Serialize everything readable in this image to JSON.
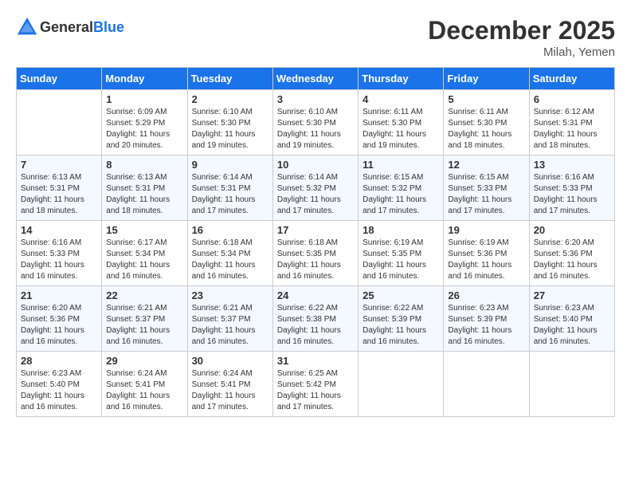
{
  "header": {
    "logo_general": "General",
    "logo_blue": "Blue",
    "month_title": "December 2025",
    "location": "Milah, Yemen"
  },
  "weekdays": [
    "Sunday",
    "Monday",
    "Tuesday",
    "Wednesday",
    "Thursday",
    "Friday",
    "Saturday"
  ],
  "weeks": [
    [
      {
        "day": "",
        "sunrise": "",
        "sunset": "",
        "daylight": ""
      },
      {
        "day": "1",
        "sunrise": "Sunrise: 6:09 AM",
        "sunset": "Sunset: 5:29 PM",
        "daylight": "Daylight: 11 hours and 20 minutes."
      },
      {
        "day": "2",
        "sunrise": "Sunrise: 6:10 AM",
        "sunset": "Sunset: 5:30 PM",
        "daylight": "Daylight: 11 hours and 19 minutes."
      },
      {
        "day": "3",
        "sunrise": "Sunrise: 6:10 AM",
        "sunset": "Sunset: 5:30 PM",
        "daylight": "Daylight: 11 hours and 19 minutes."
      },
      {
        "day": "4",
        "sunrise": "Sunrise: 6:11 AM",
        "sunset": "Sunset: 5:30 PM",
        "daylight": "Daylight: 11 hours and 19 minutes."
      },
      {
        "day": "5",
        "sunrise": "Sunrise: 6:11 AM",
        "sunset": "Sunset: 5:30 PM",
        "daylight": "Daylight: 11 hours and 18 minutes."
      },
      {
        "day": "6",
        "sunrise": "Sunrise: 6:12 AM",
        "sunset": "Sunset: 5:31 PM",
        "daylight": "Daylight: 11 hours and 18 minutes."
      }
    ],
    [
      {
        "day": "7",
        "sunrise": "Sunrise: 6:13 AM",
        "sunset": "Sunset: 5:31 PM",
        "daylight": "Daylight: 11 hours and 18 minutes."
      },
      {
        "day": "8",
        "sunrise": "Sunrise: 6:13 AM",
        "sunset": "Sunset: 5:31 PM",
        "daylight": "Daylight: 11 hours and 18 minutes."
      },
      {
        "day": "9",
        "sunrise": "Sunrise: 6:14 AM",
        "sunset": "Sunset: 5:31 PM",
        "daylight": "Daylight: 11 hours and 17 minutes."
      },
      {
        "day": "10",
        "sunrise": "Sunrise: 6:14 AM",
        "sunset": "Sunset: 5:32 PM",
        "daylight": "Daylight: 11 hours and 17 minutes."
      },
      {
        "day": "11",
        "sunrise": "Sunrise: 6:15 AM",
        "sunset": "Sunset: 5:32 PM",
        "daylight": "Daylight: 11 hours and 17 minutes."
      },
      {
        "day": "12",
        "sunrise": "Sunrise: 6:15 AM",
        "sunset": "Sunset: 5:33 PM",
        "daylight": "Daylight: 11 hours and 17 minutes."
      },
      {
        "day": "13",
        "sunrise": "Sunrise: 6:16 AM",
        "sunset": "Sunset: 5:33 PM",
        "daylight": "Daylight: 11 hours and 17 minutes."
      }
    ],
    [
      {
        "day": "14",
        "sunrise": "Sunrise: 6:16 AM",
        "sunset": "Sunset: 5:33 PM",
        "daylight": "Daylight: 11 hours and 16 minutes."
      },
      {
        "day": "15",
        "sunrise": "Sunrise: 6:17 AM",
        "sunset": "Sunset: 5:34 PM",
        "daylight": "Daylight: 11 hours and 16 minutes."
      },
      {
        "day": "16",
        "sunrise": "Sunrise: 6:18 AM",
        "sunset": "Sunset: 5:34 PM",
        "daylight": "Daylight: 11 hours and 16 minutes."
      },
      {
        "day": "17",
        "sunrise": "Sunrise: 6:18 AM",
        "sunset": "Sunset: 5:35 PM",
        "daylight": "Daylight: 11 hours and 16 minutes."
      },
      {
        "day": "18",
        "sunrise": "Sunrise: 6:19 AM",
        "sunset": "Sunset: 5:35 PM",
        "daylight": "Daylight: 11 hours and 16 minutes."
      },
      {
        "day": "19",
        "sunrise": "Sunrise: 6:19 AM",
        "sunset": "Sunset: 5:36 PM",
        "daylight": "Daylight: 11 hours and 16 minutes."
      },
      {
        "day": "20",
        "sunrise": "Sunrise: 6:20 AM",
        "sunset": "Sunset: 5:36 PM",
        "daylight": "Daylight: 11 hours and 16 minutes."
      }
    ],
    [
      {
        "day": "21",
        "sunrise": "Sunrise: 6:20 AM",
        "sunset": "Sunset: 5:36 PM",
        "daylight": "Daylight: 11 hours and 16 minutes."
      },
      {
        "day": "22",
        "sunrise": "Sunrise: 6:21 AM",
        "sunset": "Sunset: 5:37 PM",
        "daylight": "Daylight: 11 hours and 16 minutes."
      },
      {
        "day": "23",
        "sunrise": "Sunrise: 6:21 AM",
        "sunset": "Sunset: 5:37 PM",
        "daylight": "Daylight: 11 hours and 16 minutes."
      },
      {
        "day": "24",
        "sunrise": "Sunrise: 6:22 AM",
        "sunset": "Sunset: 5:38 PM",
        "daylight": "Daylight: 11 hours and 16 minutes."
      },
      {
        "day": "25",
        "sunrise": "Sunrise: 6:22 AM",
        "sunset": "Sunset: 5:39 PM",
        "daylight": "Daylight: 11 hours and 16 minutes."
      },
      {
        "day": "26",
        "sunrise": "Sunrise: 6:23 AM",
        "sunset": "Sunset: 5:39 PM",
        "daylight": "Daylight: 11 hours and 16 minutes."
      },
      {
        "day": "27",
        "sunrise": "Sunrise: 6:23 AM",
        "sunset": "Sunset: 5:40 PM",
        "daylight": "Daylight: 11 hours and 16 minutes."
      }
    ],
    [
      {
        "day": "28",
        "sunrise": "Sunrise: 6:23 AM",
        "sunset": "Sunset: 5:40 PM",
        "daylight": "Daylight: 11 hours and 16 minutes."
      },
      {
        "day": "29",
        "sunrise": "Sunrise: 6:24 AM",
        "sunset": "Sunset: 5:41 PM",
        "daylight": "Daylight: 11 hours and 16 minutes."
      },
      {
        "day": "30",
        "sunrise": "Sunrise: 6:24 AM",
        "sunset": "Sunset: 5:41 PM",
        "daylight": "Daylight: 11 hours and 17 minutes."
      },
      {
        "day": "31",
        "sunrise": "Sunrise: 6:25 AM",
        "sunset": "Sunset: 5:42 PM",
        "daylight": "Daylight: 11 hours and 17 minutes."
      },
      {
        "day": "",
        "sunrise": "",
        "sunset": "",
        "daylight": ""
      },
      {
        "day": "",
        "sunrise": "",
        "sunset": "",
        "daylight": ""
      },
      {
        "day": "",
        "sunrise": "",
        "sunset": "",
        "daylight": ""
      }
    ]
  ]
}
